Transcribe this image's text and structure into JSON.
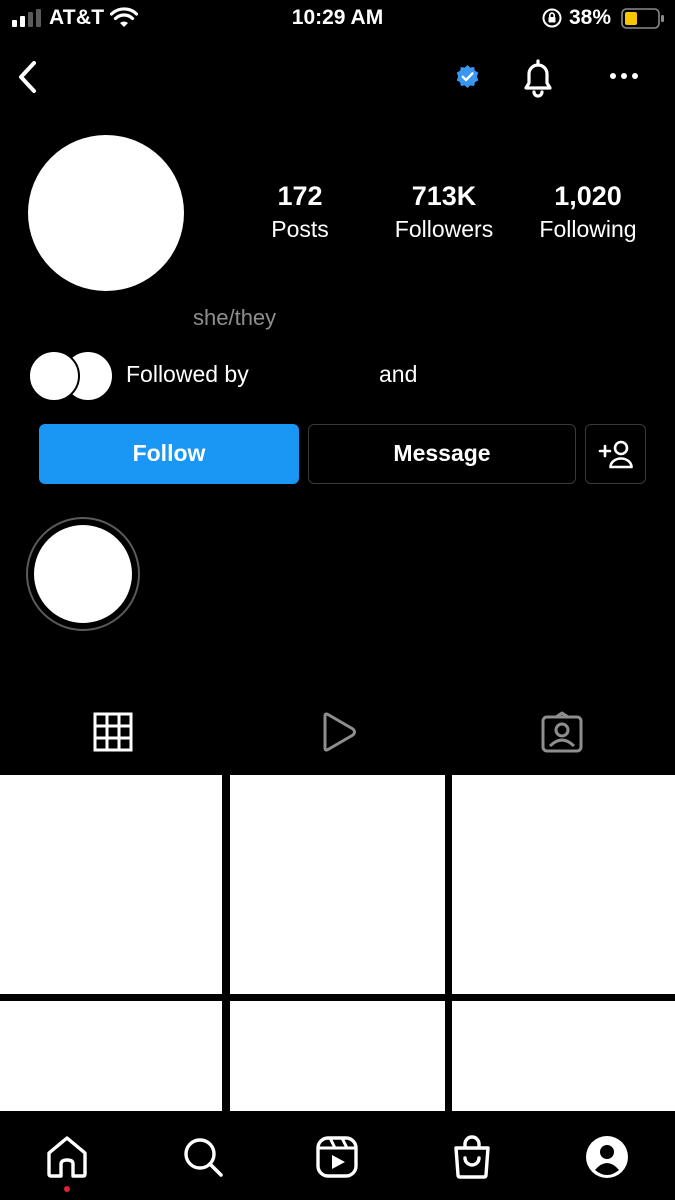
{
  "status_bar": {
    "carrier": "AT&T",
    "time": "10:29 AM",
    "battery": "38%",
    "battery_color": "#f7c600"
  },
  "header": {
    "verified_color": "#3897f0",
    "icons": [
      "back-icon",
      "verified-badge-icon",
      "bell-icon",
      "more-options-icon"
    ]
  },
  "profile": {
    "stats": [
      {
        "value": "172",
        "label": "Posts"
      },
      {
        "value": "713K",
        "label": "Followers"
      },
      {
        "value": "1,020",
        "label": "Following"
      }
    ],
    "pronouns": "she/they",
    "followed_by": "Followed by",
    "and_text": "and"
  },
  "actions": {
    "follow": "Follow",
    "message": "Message",
    "follow_color": "#1a96f5"
  },
  "tabs": [
    "grid-icon",
    "reels-icon",
    "tagged-icon"
  ],
  "bottom_nav": [
    "home-icon",
    "search-icon",
    "reels-icon",
    "shop-icon",
    "profile-icon"
  ]
}
